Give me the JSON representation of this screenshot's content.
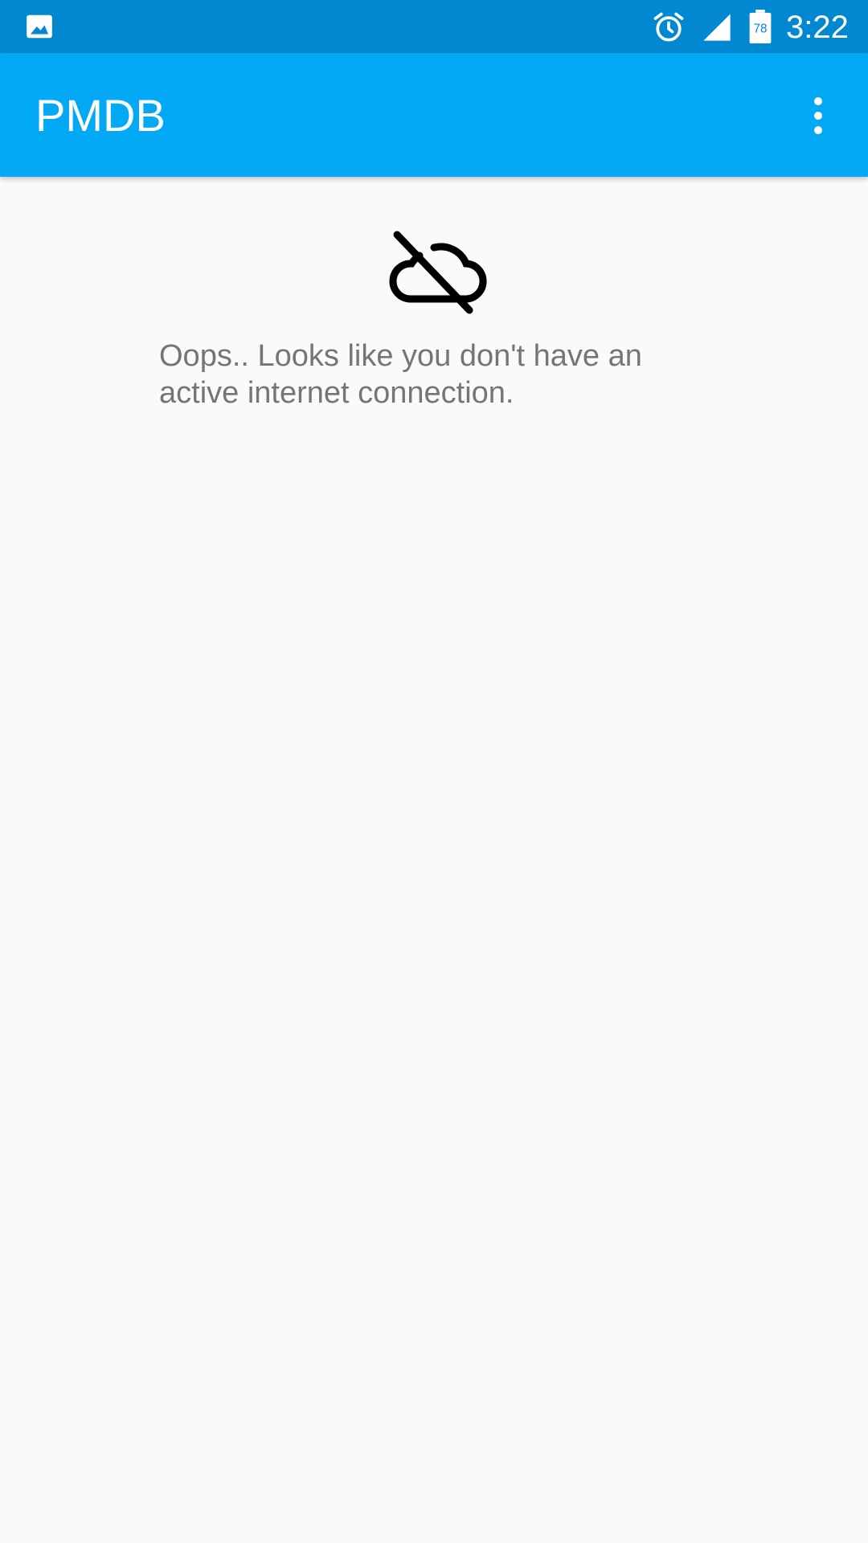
{
  "status_bar": {
    "time": "3:22",
    "battery_level": "78",
    "icons": [
      "image-icon",
      "alarm-icon",
      "signal-icon",
      "battery-icon"
    ]
  },
  "app_bar": {
    "title": "PMDB",
    "overflow_icon": "more-vert-icon"
  },
  "main": {
    "icon": "cloud-off-icon",
    "message": "Oops.. Looks like you don't have an active internet connection."
  },
  "colors": {
    "status_bar": "#0288d1",
    "app_bar": "#03a9f4",
    "background": "#fafafa",
    "message_text": "#757575"
  }
}
